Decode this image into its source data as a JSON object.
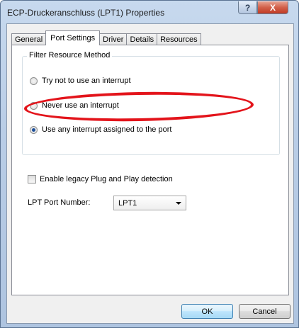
{
  "window": {
    "title": "ECP-Druckeranschluss (LPT1) Properties",
    "help_label": "?",
    "close_label": "X"
  },
  "tabs": [
    {
      "label": "General",
      "active": false
    },
    {
      "label": "Port Settings",
      "active": true
    },
    {
      "label": "Driver",
      "active": false
    },
    {
      "label": "Details",
      "active": false
    },
    {
      "label": "Resources",
      "active": false
    }
  ],
  "filter_group": {
    "legend": "Filter Resource Method",
    "options": [
      {
        "label": "Try not to use an interrupt",
        "selected": false
      },
      {
        "label": "Never use an interrupt",
        "selected": false
      },
      {
        "label": "Use any interrupt assigned to the port",
        "selected": true
      }
    ]
  },
  "legacy_pnp": {
    "label": "Enable legacy Plug and Play detection",
    "checked": false
  },
  "lpt_port": {
    "label": "LPT Port Number:",
    "value": "LPT1"
  },
  "buttons": {
    "ok": "OK",
    "cancel": "Cancel"
  },
  "colors": {
    "highlight_ellipse": "#e3141b",
    "title_bar": "#b9cde6"
  }
}
